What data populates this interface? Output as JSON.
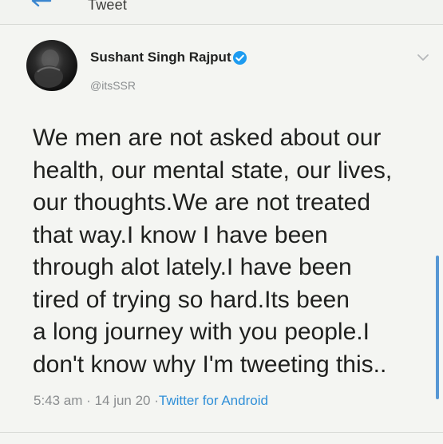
{
  "header": {
    "title": "Tweet"
  },
  "tweet": {
    "author_name": "Sushant Singh Rajput",
    "handle": "@itsSSR",
    "text_lines": [
      "We men are not asked about our",
      "health, our mental state, our lives,",
      "our thoughts.We are not treated",
      "that way.I know I have been",
      "through alot lately.I have been",
      "tired of trying so hard.Its been",
      "a long journey with you people.I",
      "don't know why I'm tweeting this.."
    ],
    "time": "5:43 am",
    "date": "14 jun 20",
    "source": "Twitter for Android"
  },
  "icons": {
    "back": "arrow-left-icon",
    "verified": "verified-badge-icon",
    "menu": "chevron-down-icon"
  },
  "colors": {
    "background": "#f4f5f2",
    "link_blue": "#2f8fd8",
    "verified_blue": "#1d9bf0",
    "muted_text": "#8a8d8f"
  }
}
